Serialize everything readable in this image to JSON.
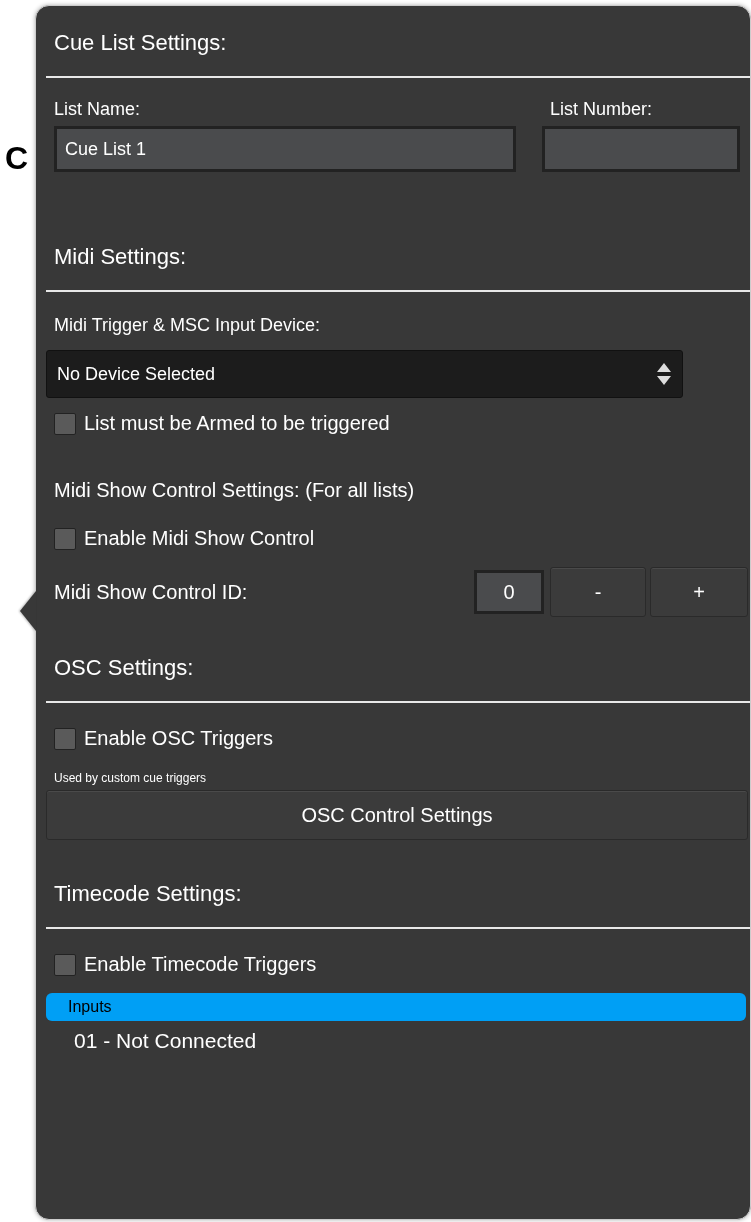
{
  "background_text": "C",
  "cue_list_settings": {
    "title": "Cue List Settings:",
    "list_name": {
      "label": "List Name:",
      "value": "Cue List 1"
    },
    "list_number": {
      "label": "List Number:"
    }
  },
  "midi_settings": {
    "title": "Midi Settings:",
    "device_label": "Midi Trigger & MSC Input Device:",
    "device_select": "No Device Selected",
    "armed_checkbox": {
      "label": "List must be Armed to be triggered",
      "checked": false
    },
    "msc_heading": "Midi Show Control Settings: (For all lists)",
    "msc_checkbox": {
      "label": "Enable Midi Show Control",
      "checked": false
    },
    "msc_id": {
      "label": "Midi Show Control ID:",
      "value": "0",
      "decrement": "-",
      "increment": "+"
    }
  },
  "osc_settings": {
    "title": "OSC Settings:",
    "checkbox": {
      "label": "Enable OSC Triggers",
      "checked": false
    },
    "note": "Used by custom cue triggers",
    "button": "OSC Control Settings"
  },
  "timecode_settings": {
    "title": "Timecode Settings:",
    "checkbox": {
      "label": "Enable Timecode Triggers",
      "checked": false
    },
    "inputs": {
      "header": "Inputs",
      "rows": [
        "01 - Not Connected"
      ]
    }
  }
}
